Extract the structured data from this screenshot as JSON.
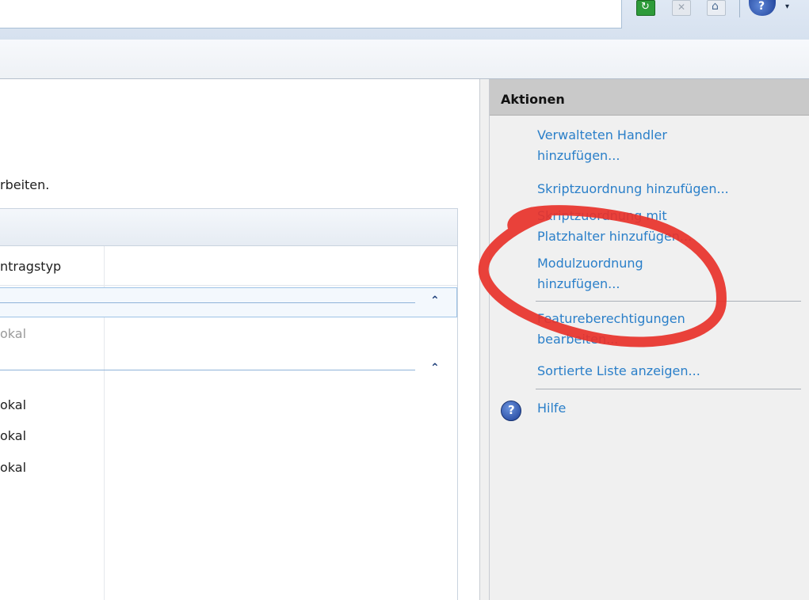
{
  "toolbar": {
    "icons": [
      "refresh-icon",
      "stop-icon",
      "home-icon",
      "help-icon",
      "dropdown-arrow-icon"
    ],
    "dropdown_glyph": "▾"
  },
  "main": {
    "description_fragment": "rbeiten.",
    "column_header": "ntragstyp",
    "groups": [
      {
        "chevron": "⌃",
        "selected": true
      },
      {
        "chevron": "⌃",
        "selected": false
      }
    ],
    "rows": [
      {
        "text": "okal",
        "style": "muted"
      },
      {
        "text": "okal",
        "style": "normal"
      },
      {
        "text": "okal",
        "style": "normal"
      },
      {
        "text": "okal",
        "style": "normal"
      }
    ]
  },
  "actions": {
    "title": "Aktionen",
    "items": [
      {
        "line1": "Verwalteten Handler",
        "line2": "hinzufügen..."
      },
      {
        "line1": "Skriptzuordnung hinzufügen...",
        "line2": ""
      },
      {
        "line1": "Skriptzuordnung mit",
        "line2": "Platzhalter hinzufügen..."
      },
      {
        "line1": "Modulzuordnung",
        "line2": "hinzufügen..."
      },
      {
        "line1": "Featureberechtigungen",
        "line2": "bearbeiten..."
      },
      {
        "line1": "Sortierte Liste anzeigen...",
        "line2": ""
      }
    ],
    "help_label": "Hilfe"
  },
  "colors": {
    "link": "#2a7fc9",
    "annotation": "#e8322a",
    "header_bg": "#c9c9c9"
  }
}
